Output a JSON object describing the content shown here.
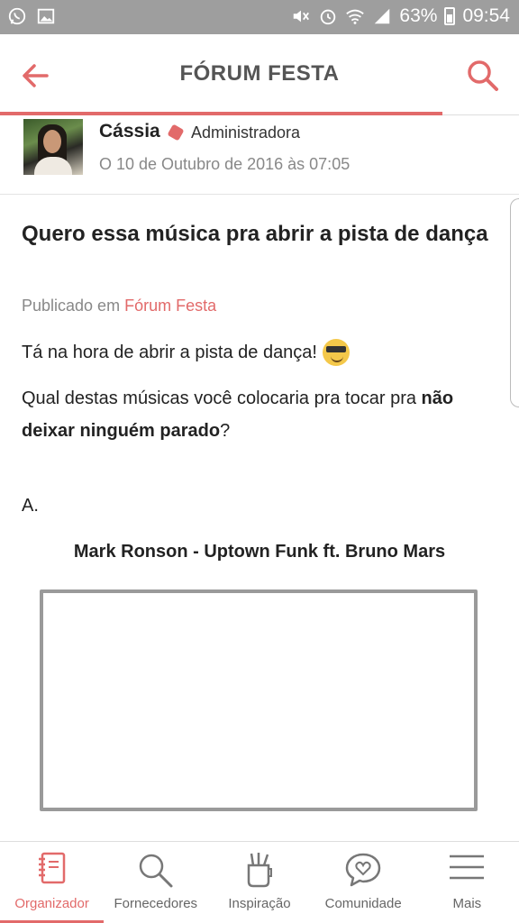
{
  "status_bar": {
    "battery_text": "63%",
    "time": "09:54",
    "left_icons": [
      "whatsapp-icon",
      "image-icon"
    ],
    "right_icons": [
      "mute-icon",
      "alarm-icon",
      "wifi-icon",
      "signal-icon",
      "battery-icon"
    ]
  },
  "header": {
    "title": "FÓRUM FESTA",
    "accent": "#e26a6a"
  },
  "author": {
    "name": "Cássia",
    "role": "Administradora",
    "date": "O 10 de Outubro de 2016 às 07:05"
  },
  "post": {
    "title": "Quero essa música pra abrir a pista de dança",
    "published_prefix": "Publicado em",
    "forum_link": "Fórum Festa",
    "p1": "Tá na hora de abrir a pista de dança!",
    "p2_start": "Qual destas músicas você colocaria pra tocar pra",
    "p2_bold": "não deixar ninguém parado",
    "p2_end": "?",
    "option_label": "A.",
    "song_title": "Mark Ronson - Uptown Funk ft. Bruno Mars"
  },
  "bottom_nav": [
    {
      "label": "Organizador",
      "icon": "notebook-icon",
      "active": true
    },
    {
      "label": "Fornecedores",
      "icon": "search-icon",
      "active": false
    },
    {
      "label": "Inspiração",
      "icon": "cup-icon",
      "active": false
    },
    {
      "label": "Comunidade",
      "icon": "chat-heart-icon",
      "active": false
    },
    {
      "label": "Mais",
      "icon": "menu-icon",
      "active": false
    }
  ]
}
